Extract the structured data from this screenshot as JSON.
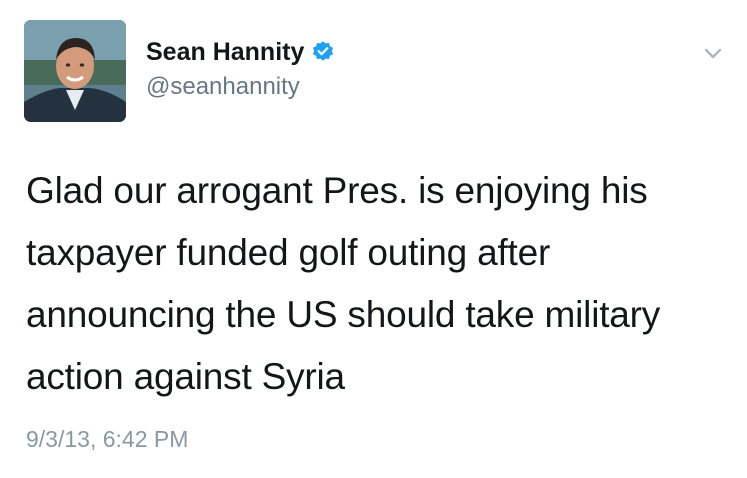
{
  "tweet": {
    "author": {
      "display_name": "Sean Hannity",
      "handle": "@seanhannity",
      "verified": true,
      "avatar_icon": "profile-photo"
    },
    "text_lines": [
      "Glad our arrogant Pres. is enjoying his",
      "taxpayer funded golf outing after",
      "announcing the US should take military",
      "action against Syria"
    ],
    "timestamp": "9/3/13, 6:42 PM",
    "menu_icon": "chevron-down-icon"
  },
  "colors": {
    "text_primary": "#14171a",
    "text_secondary": "#657786",
    "timestamp": "#8899a6",
    "verified_badge": "#1da1f2",
    "chevron": "#aab8c2"
  }
}
